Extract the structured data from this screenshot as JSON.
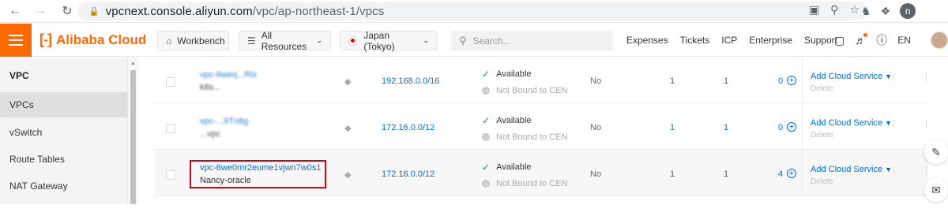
{
  "browser": {
    "url_host": "vpcnext.console.aliyun.com",
    "url_path": "/vpc/ap-northeast-1/vpcs",
    "profile_initial": "n",
    "icons": [
      "back-icon",
      "forward-icon",
      "reload-icon",
      "lock-icon",
      "translate-icon",
      "zoom-icon",
      "star-icon",
      "extension-icon",
      "puzzle-icon"
    ]
  },
  "header": {
    "brand": "Alibaba Cloud",
    "workbench": "Workbench",
    "all_resources": "All Resources",
    "region": "Japan (Tokyo)",
    "search_placeholder": "Search...",
    "links": [
      "Expenses",
      "Tickets",
      "ICP",
      "Enterprise",
      "Support"
    ],
    "language": "EN",
    "accent_color": "#ff6a00"
  },
  "sidebar": {
    "title": "VPC",
    "items": [
      {
        "label": "VPCs",
        "active": true
      },
      {
        "label": "vSwitch",
        "active": false
      },
      {
        "label": "Route Tables",
        "active": false
      },
      {
        "label": "NAT Gateway",
        "active": false
      }
    ]
  },
  "table": {
    "rows": [
      {
        "id": "vpc-6weq...Rlx",
        "name": "k8s...",
        "cidr": "192.168.0.0/16",
        "status": "Available",
        "cen": "Not Bound to CEN",
        "default": "No",
        "c1": "1",
        "c2": "1",
        "c3": "0",
        "action": "Add Cloud Service",
        "delete": "Delete",
        "obscured": true
      },
      {
        "id": "vpc-...9Tn8g",
        "name": "...vpc",
        "cidr": "172.16.0.0/12",
        "status": "Available",
        "cen": "Not Bound to CEN",
        "default": "No",
        "c1": "1",
        "c2": "1",
        "c3": "0",
        "action": "Add Cloud Service",
        "delete": "Delete",
        "obscured": true
      },
      {
        "id": "vpc-6we0mr2eume1vjwn7w0s1",
        "name": "Nancy-oracle",
        "cidr": "172.16.0.0/12",
        "status": "Available",
        "cen": "Not Bound to CEN",
        "default": "No",
        "c1": "1",
        "c2": "1",
        "c3": "4",
        "action": "Add Cloud Service",
        "delete": "Delete",
        "obscured": false,
        "highlighted": true
      }
    ]
  }
}
